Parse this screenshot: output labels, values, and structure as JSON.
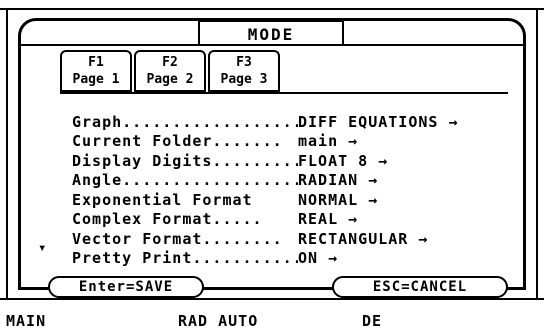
{
  "dialog": {
    "title": "MODE"
  },
  "tabs": [
    {
      "key": "F1",
      "page": "Page 1"
    },
    {
      "key": "F2",
      "page": "Page 2"
    },
    {
      "key": "F3",
      "page": "Page 3"
    }
  ],
  "settings": [
    {
      "label": "Graph....................",
      "value": "DIFF EQUATIONS →"
    },
    {
      "label": "Current Folder.......",
      "value": "main →"
    },
    {
      "label": "Display Digits.........",
      "value": "FLOAT 8 →"
    },
    {
      "label": "Angle....................",
      "value": "RADIAN →"
    },
    {
      "label": "Exponential Format",
      "value": "NORMAL →"
    },
    {
      "label": "Complex Format.....",
      "value": "REAL →"
    },
    {
      "label": "Vector Format........",
      "value": "RECTANGULAR →"
    },
    {
      "label": "Pretty Print...........",
      "value": "ON →"
    }
  ],
  "buttons": {
    "save": "Enter=SAVE",
    "cancel": "ESC=CANCEL"
  },
  "status_bar": {
    "folder": "MAIN",
    "mode": "RAD AUTO",
    "graph": "DE"
  },
  "icons": {
    "scroll": "scroll-down-arrow-icon"
  }
}
